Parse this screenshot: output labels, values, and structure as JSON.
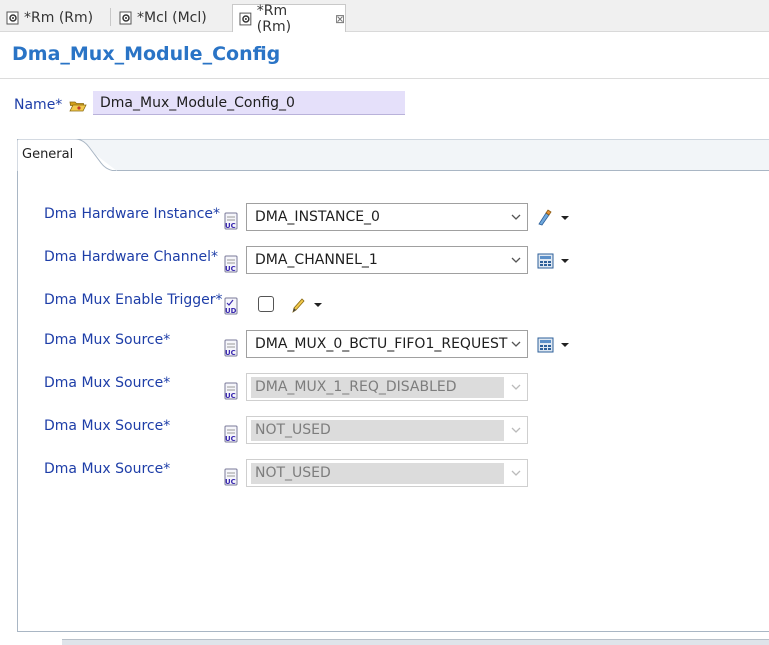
{
  "tabs": [
    {
      "label": "*Rm (Rm)",
      "active": false
    },
    {
      "label": "*Mcl (Mcl)",
      "active": false
    },
    {
      "label": "*Rm (Rm)",
      "active": true
    }
  ],
  "close_glyph": "⊠",
  "page_title": "Dma_Mux_Module_Config",
  "name": {
    "label": "Name*",
    "value": "Dma_Mux_Module_Config_0"
  },
  "section_tab": "General",
  "fields": [
    {
      "label": "Dma Hardware Instance*",
      "value": "DMA_INSTANCE_0",
      "enabled": true,
      "action_icon": "brush-edit-icon"
    },
    {
      "label": "Dma Hardware Channel*",
      "value": "DMA_CHANNEL_1",
      "enabled": true,
      "action_icon": "calculator-icon"
    },
    {
      "label": "Dma Mux Enable Trigger*",
      "checked": false,
      "action_icon": "pencil-icon"
    },
    {
      "label": "Dma Mux Source*",
      "value": "DMA_MUX_0_BCTU_FIFO1_REQUEST",
      "enabled": true,
      "action_icon": "calculator-icon"
    },
    {
      "label": "Dma Mux Source*",
      "value": "DMA_MUX_1_REQ_DISABLED",
      "enabled": false
    },
    {
      "label": "Dma Mux Source*",
      "value": "NOT_USED",
      "enabled": false
    },
    {
      "label": "Dma Mux Source*",
      "value": "NOT_USED",
      "enabled": false
    }
  ],
  "colors": {
    "title": "#2a74c6",
    "label": "#1e3ea8",
    "name_field_bg": "#e5e0fa"
  }
}
